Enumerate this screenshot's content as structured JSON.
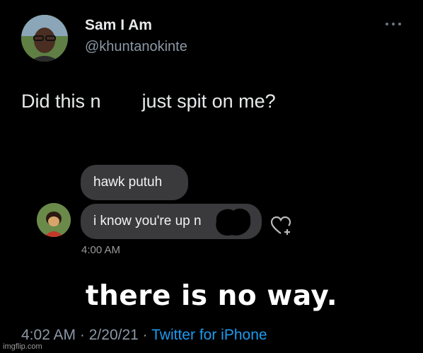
{
  "tweet": {
    "author": {
      "display_name": "Sam I Am",
      "handle": "@khuntanokinte",
      "avatar_icon": "profile-photo"
    },
    "more_icon": "more-horizontal-icon",
    "text_part_a": "Did this n",
    "text_part_b": "just spit on me?",
    "embedded_dm": {
      "messages": [
        "hawk putuh",
        "i know you're up n"
      ],
      "time": "4:00 AM",
      "react_icon": "heart-plus-icon"
    },
    "meta": {
      "time": "4:02 AM",
      "separator": "·",
      "date": "2/20/21",
      "source": "Twitter for iPhone"
    }
  },
  "meme_caption": "there is no way.",
  "watermark": "imgflip.com",
  "colors": {
    "background": "#000000",
    "text": "#e7e9ea",
    "secondary_text": "#8b98a5",
    "link": "#1d9bf0",
    "bubble": "#3a3a3c"
  }
}
